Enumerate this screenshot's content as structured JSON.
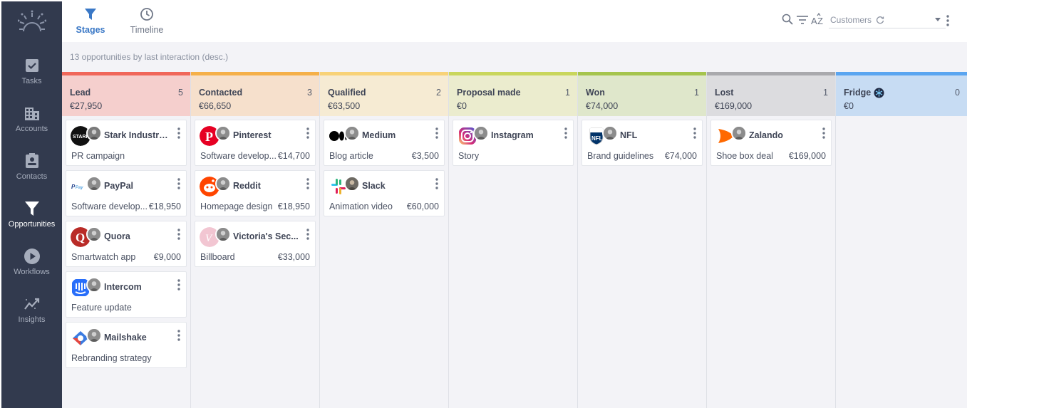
{
  "sidebar": {
    "items": [
      {
        "label": "Tasks",
        "icon": "check-square-icon"
      },
      {
        "label": "Accounts",
        "icon": "building-icon"
      },
      {
        "label": "Contacts",
        "icon": "contact-card-icon"
      },
      {
        "label": "Opportunities",
        "icon": "funnel-icon",
        "active": true
      },
      {
        "label": "Workflows",
        "icon": "play-circle-icon"
      },
      {
        "label": "Insights",
        "icon": "trend-icon"
      }
    ]
  },
  "topbar": {
    "tabs": [
      {
        "label": "Stages",
        "icon": "funnel-icon",
        "active": true
      },
      {
        "label": "Timeline",
        "icon": "clock-icon"
      }
    ],
    "filter_select": "Customers"
  },
  "board": {
    "summary": "13 opportunities by last interaction (desc.)",
    "columns": [
      {
        "name": "Lead",
        "count": "5",
        "amount": "€27,950",
        "color": "#f0675a",
        "bg": "#f5cfcd",
        "cards": [
          {
            "company": "Stark Industries",
            "desc": "PR campaign",
            "value": ""
          },
          {
            "company": "PayPal",
            "desc": "Software develop...",
            "value": "€18,950"
          },
          {
            "company": "Quora",
            "desc": "Smartwatch app",
            "value": "€9,000"
          },
          {
            "company": "Intercom",
            "desc": "Feature update",
            "value": ""
          },
          {
            "company": "Mailshake",
            "desc": "Rebranding strategy",
            "value": ""
          }
        ]
      },
      {
        "name": "Contacted",
        "count": "3",
        "amount": "€66,650",
        "color": "#f5b049",
        "bg": "#f6e0cc",
        "cards": [
          {
            "company": "Pinterest",
            "desc": "Software develop...",
            "value": "€14,700"
          },
          {
            "company": "Reddit",
            "desc": "Homepage design",
            "value": "€18,950"
          },
          {
            "company": "Victoria's Sec...",
            "desc": "Billboard",
            "value": "€33,000"
          }
        ]
      },
      {
        "name": "Qualified",
        "count": "2",
        "amount": "€63,500",
        "color": "#f8d277",
        "bg": "#f6ebd3",
        "cards": [
          {
            "company": "Medium",
            "desc": "Blog article",
            "value": "€3,500"
          },
          {
            "company": "Slack",
            "desc": "Animation video",
            "value": "€60,000"
          }
        ]
      },
      {
        "name": "Proposal made",
        "count": "1",
        "amount": "€0",
        "color": "#c9d65c",
        "bg": "#ebecce",
        "cards": [
          {
            "company": "Instagram",
            "desc": "Story",
            "value": ""
          }
        ]
      },
      {
        "name": "Won",
        "count": "1",
        "amount": "€74,000",
        "color": "#a5c44d",
        "bg": "#dfe7cb",
        "cards": [
          {
            "company": "NFL",
            "desc": "Brand guidelines",
            "value": "€74,000"
          }
        ]
      },
      {
        "name": "Lost",
        "count": "1",
        "amount": "€169,000",
        "color": "#a9a9ad",
        "bg": "#dcdcdf",
        "cards": [
          {
            "company": "Zalando",
            "desc": "Shoe box deal",
            "value": "€169,000"
          }
        ]
      },
      {
        "name": "Fridge",
        "count": "0",
        "amount": "€0",
        "color": "#5aa5f0",
        "bg": "#c7dcf3",
        "cards": []
      }
    ]
  }
}
